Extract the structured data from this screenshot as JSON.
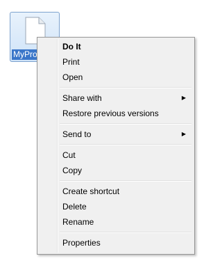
{
  "desktop": {
    "file_label": "MyProduct"
  },
  "menu": {
    "groups": [
      [
        {
          "label": "Do It",
          "bold": true
        },
        {
          "label": "Print"
        },
        {
          "label": "Open"
        }
      ],
      [
        {
          "label": "Share with",
          "submenu": true
        },
        {
          "label": "Restore previous versions"
        }
      ],
      [
        {
          "label": "Send to",
          "submenu": true
        }
      ],
      [
        {
          "label": "Cut"
        },
        {
          "label": "Copy"
        }
      ],
      [
        {
          "label": "Create shortcut"
        },
        {
          "label": "Delete"
        },
        {
          "label": "Rename"
        }
      ],
      [
        {
          "label": "Properties"
        }
      ]
    ]
  },
  "icons": {
    "file": "document-icon",
    "submenu": "chevron-right-icon"
  }
}
